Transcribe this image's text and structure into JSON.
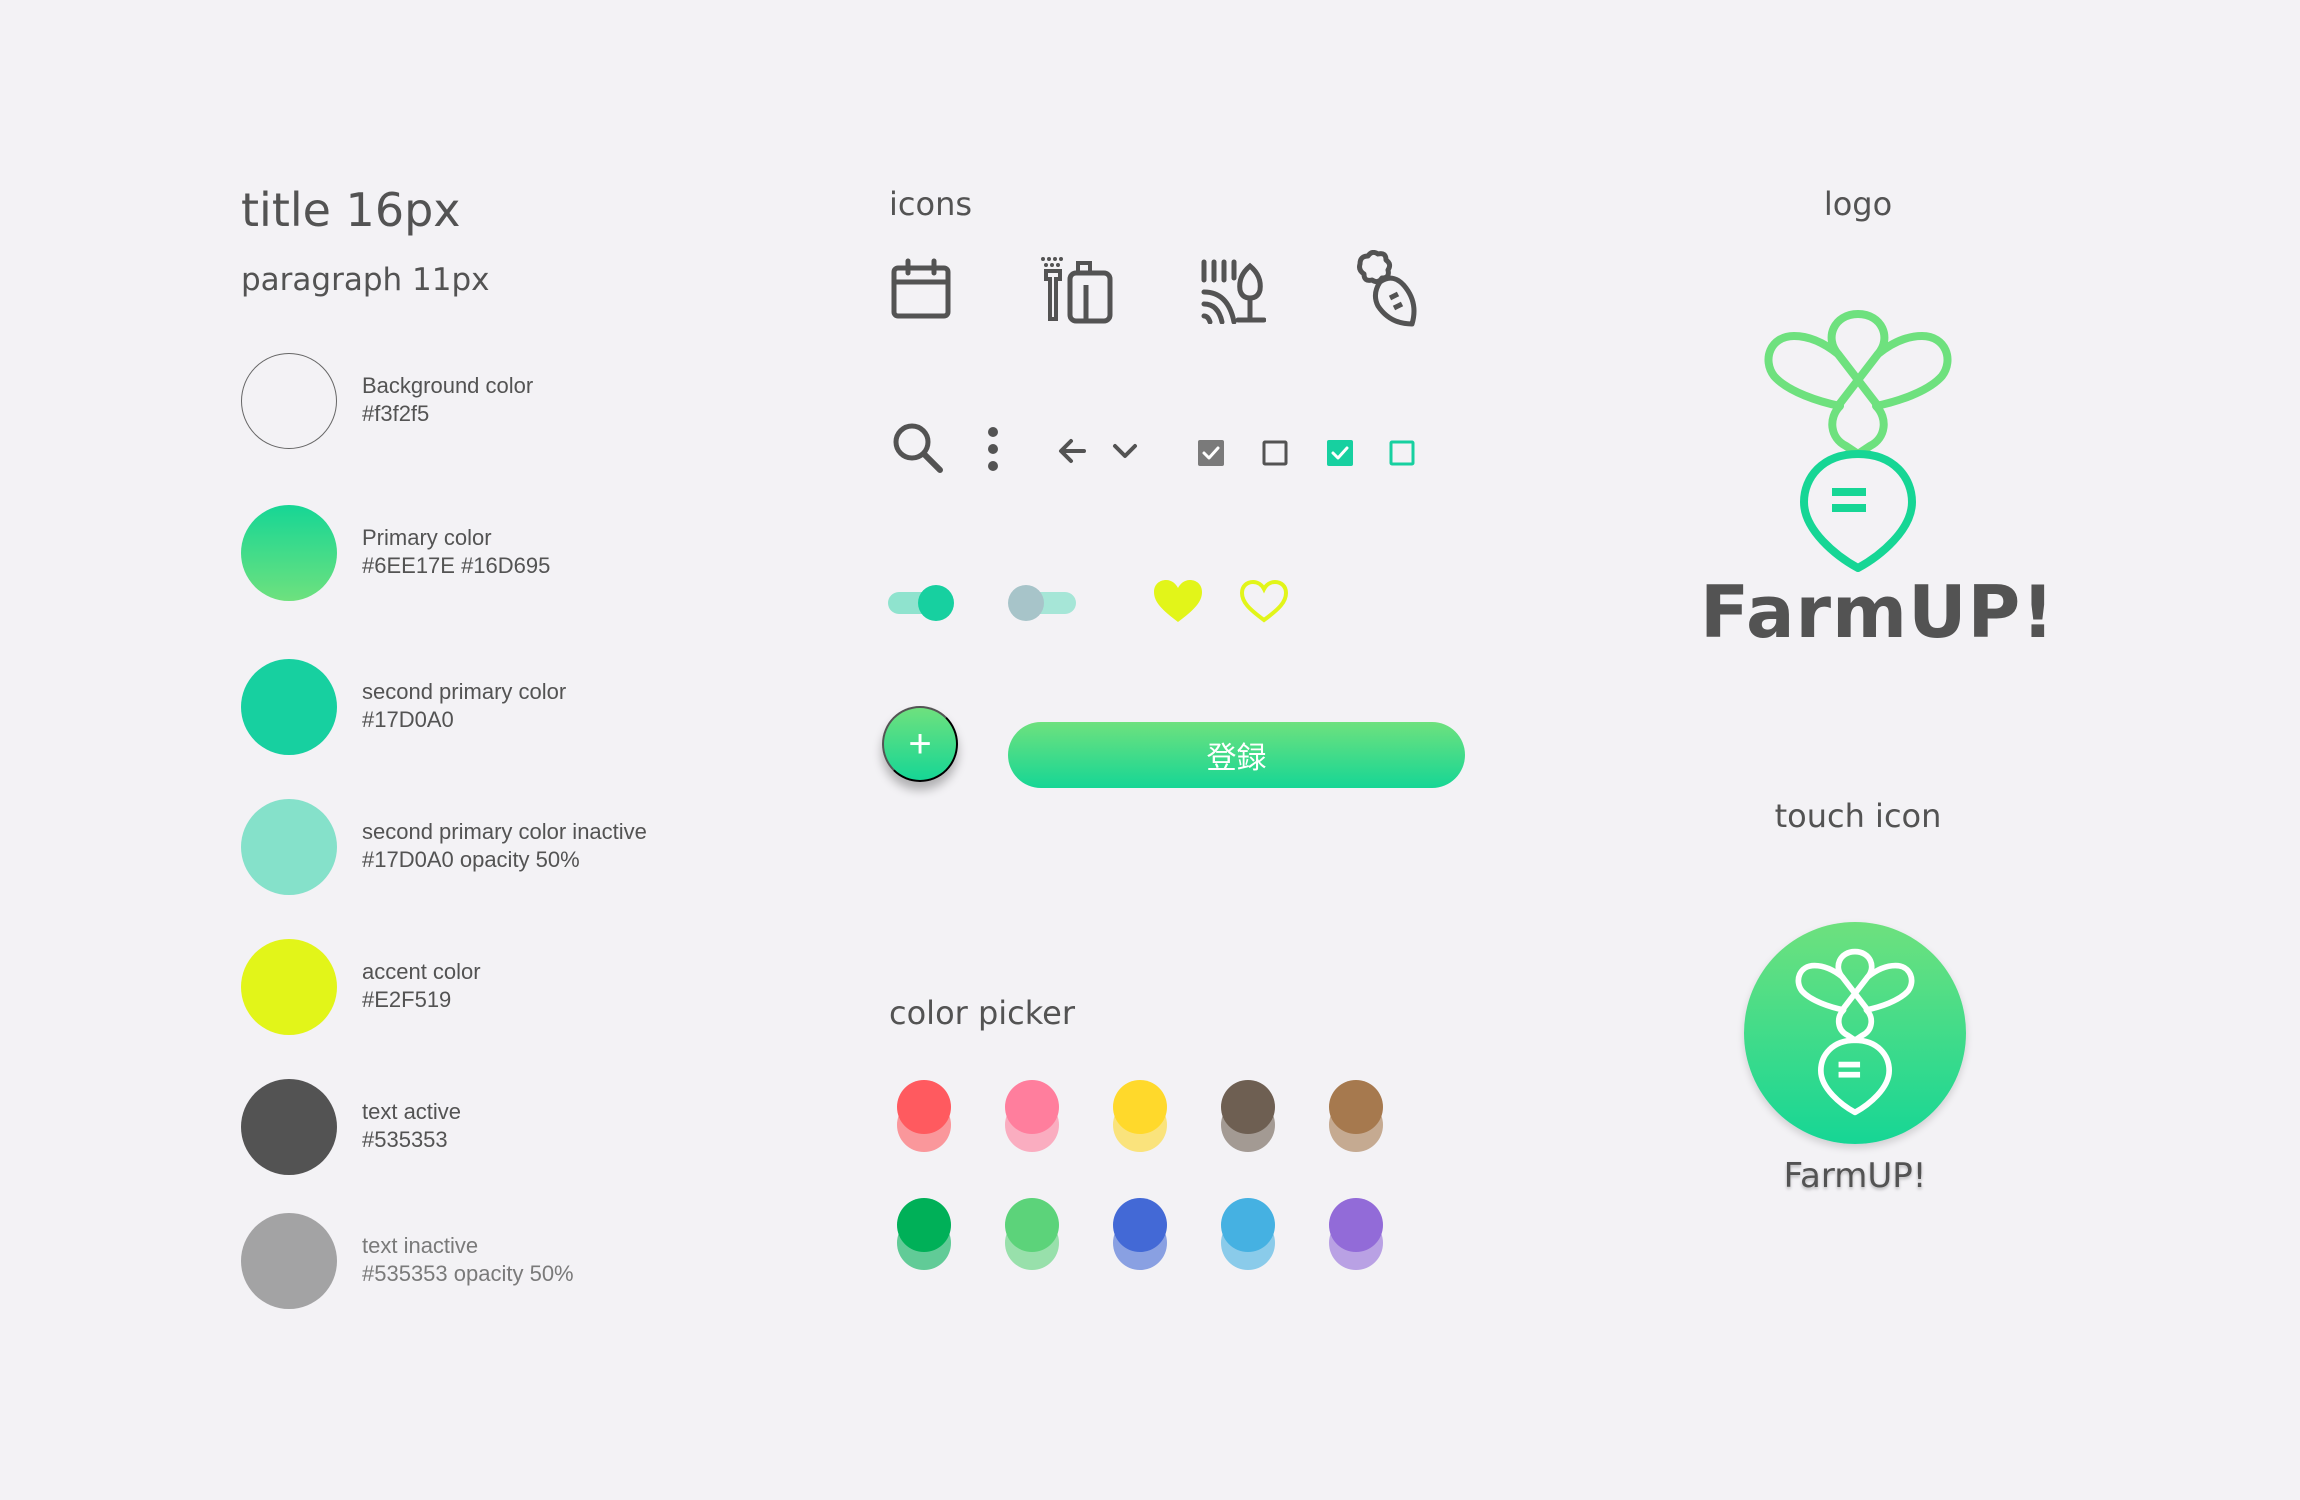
{
  "typography": {
    "title": "title 16px",
    "paragraph": "paragraph  11px"
  },
  "swatches": [
    {
      "name": "Background color",
      "value": "#f3f2f5",
      "color": "#f3f2f5"
    },
    {
      "name": "Primary color",
      "value": "#6EE17E  #16D695",
      "color": "#6EE17E",
      "color2": "#16D695"
    },
    {
      "name": "second primary color",
      "value": "#17D0A0",
      "color": "#17D0A0"
    },
    {
      "name": "second primary color inactive",
      "value": "#17D0A0 opacity 50%",
      "color": "#17D0A0"
    },
    {
      "name": "accent color",
      "value": "#E2F519",
      "color": "#E2F519"
    },
    {
      "name": "text active",
      "value": "#535353",
      "color": "#535353"
    },
    {
      "name": "text inactive",
      "value": "#535353  opacity 50%",
      "color": "#535353"
    }
  ],
  "sections": {
    "icons": "icons",
    "color_picker": "color picker",
    "logo": "logo",
    "touch_icon": "touch icon"
  },
  "icons": [
    "calendar-icon",
    "irrigation-icon",
    "field-icon",
    "carrot-icon",
    "search-icon",
    "more-vertical-icon",
    "arrow-left-icon",
    "chevron-down-icon",
    "checkbox-checked-gray-icon",
    "checkbox-empty-gray-icon",
    "checkbox-checked-green-icon",
    "checkbox-empty-green-icon",
    "heart-filled-icon",
    "heart-outline-icon"
  ],
  "toggles": [
    {
      "state": "on",
      "track": "#17D0A0",
      "knob": "#17D0A0"
    },
    {
      "state": "off",
      "track": "#17D0A0",
      "knob": "#a7c4c9"
    }
  ],
  "buttons": {
    "fab_label": "+",
    "register_label": "登録"
  },
  "color_picker": [
    [
      "#FF5A5F",
      "#FF7E9D",
      "#FFD92B",
      "#6E5F52",
      "#A6794E"
    ],
    [
      "#00B058",
      "#5CD37A",
      "#4369D6",
      "#45B1E2",
      "#926BD8"
    ]
  ],
  "logo": {
    "name": "FarmUP!",
    "touch_name": "FarmUP!"
  }
}
